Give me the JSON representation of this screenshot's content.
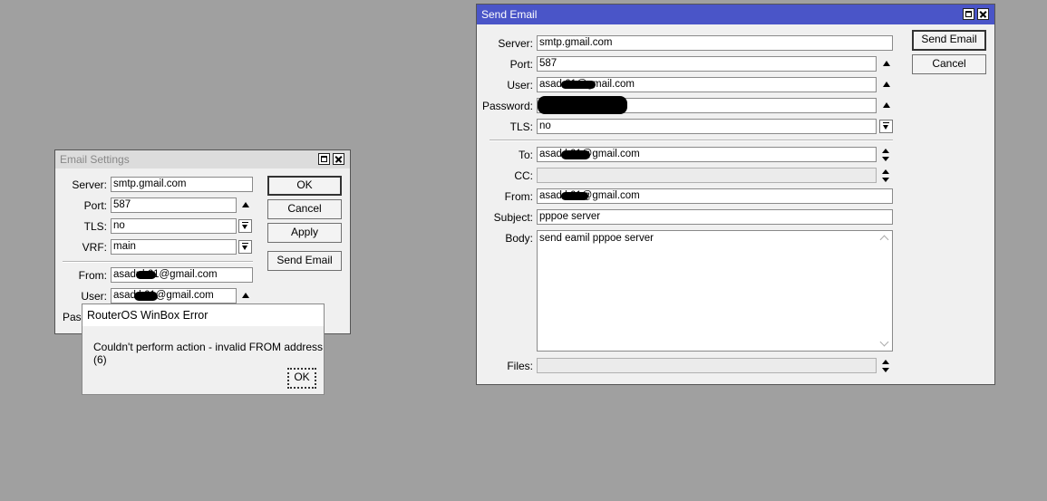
{
  "email_settings": {
    "title": "Email Settings",
    "labels": {
      "server": "Server:",
      "port": "Port:",
      "tls": "TLS:",
      "vrf": "VRF:",
      "from": "From:",
      "user": "User:",
      "pass_partial": "Pass"
    },
    "values": {
      "server": "smtp.gmail.com",
      "port": "587",
      "tls": "no",
      "vrf": "main",
      "from": "asadr        k61@gmail.com",
      "user": "asad        k61@gmail.com"
    },
    "buttons": {
      "ok": "OK",
      "cancel": "Cancel",
      "apply": "Apply",
      "send_email": "Send Email"
    }
  },
  "error_dialog": {
    "title": "RouterOS WinBox Error",
    "message": "Couldn't perform action - invalid FROM address (6)",
    "ok": "OK"
  },
  "send_email": {
    "title": "Send Email",
    "title_bar_color": "#4a55c8",
    "labels": {
      "server": "Server:",
      "port": "Port:",
      "user": "User:",
      "password": "Password:",
      "tls": "TLS:",
      "to": "To:",
      "cc": "CC:",
      "from": "From:",
      "subject": "Subject:",
      "body": "Body:",
      "files": "Files:"
    },
    "values": {
      "server": "smtp.gmail.com",
      "port": "587",
      "user": "asad          61@gmail.com",
      "tls": "no",
      "to": "asad         k61@gmail.com",
      "cc": "",
      "from": "asad         k61@gmail.com",
      "subject": "pppoe server",
      "body": "send eamil pppoe server",
      "files": ""
    },
    "buttons": {
      "send_email": "Send Email",
      "cancel": "Cancel"
    }
  }
}
